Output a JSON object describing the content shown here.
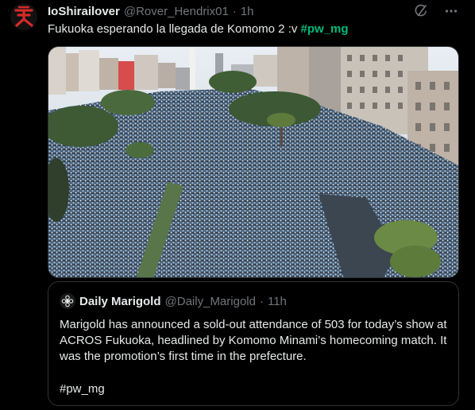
{
  "tweet": {
    "author_name": "IoShirailover",
    "author_handle": "@Rover_Hendrix01",
    "separator": "·",
    "time": "1h",
    "text_main": "Fukuoka esperando la llegada de Komomo 2 :v ",
    "text_hashtag": "#pw_mg",
    "icons": [
      "grok-icon",
      "more-icon"
    ],
    "media_alt": "crowd photo",
    "colors": {
      "accent": "#1d9bf0",
      "hashtag_green": "#00ba7c",
      "muted": "#71767b",
      "border": "#2f3336"
    }
  },
  "quote": {
    "author_name": "Daily Marigold",
    "author_handle": "@Daily_Marigold",
    "separator": "·",
    "time": "11h",
    "body": "Marigold has announced a sold-out attendance of 503 for today’s show at ACROS Fukuoka, headlined by Komomo Minami’s homecoming match. It was the promotion’s first time in the prefecture.",
    "hashtag": "#pw_mg"
  }
}
